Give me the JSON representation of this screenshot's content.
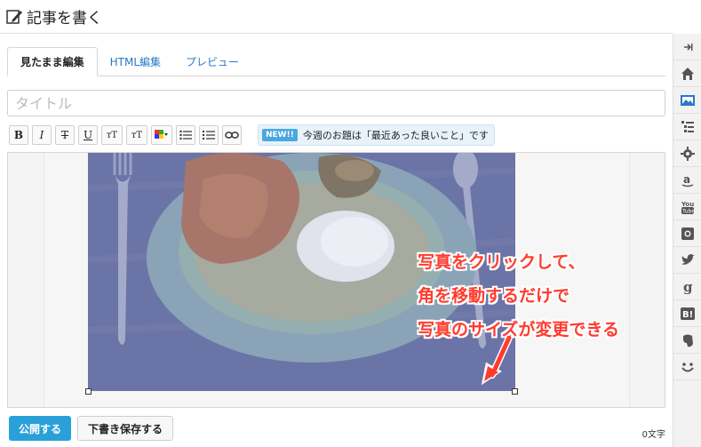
{
  "header": {
    "title": "記事を書く"
  },
  "tabs": [
    {
      "label": "見たまま編集",
      "active": true
    },
    {
      "label": "HTML編集",
      "active": false
    },
    {
      "label": "プレビュー",
      "active": false
    }
  ],
  "title_input": {
    "placeholder": "タイトル",
    "value": ""
  },
  "toolbar": {
    "bold": "B",
    "italic": "I",
    "strike": "T",
    "underline": "U",
    "size_up": "тT",
    "size_down": "тT"
  },
  "theme": {
    "badge": "NEW!!",
    "text": "今週のお題は「最近あった良いこと」です"
  },
  "annotation": {
    "lines": [
      "写真をクリックして、",
      "角を移動するだけで",
      "写真のサイズが変更できる"
    ],
    "color": "#ff3b2e"
  },
  "footer": {
    "publish_label": "公開する",
    "draft_label": "下書き保存する",
    "char_count": "0文字"
  },
  "sidebar": {
    "items": [
      {
        "icon": "collapse-icon"
      },
      {
        "icon": "home-icon"
      },
      {
        "icon": "photo-icon"
      },
      {
        "icon": "category-icon"
      },
      {
        "icon": "gear-icon"
      },
      {
        "icon": "amazon-icon"
      },
      {
        "icon": "youtube-icon",
        "text": "You"
      },
      {
        "icon": "instagram-icon"
      },
      {
        "icon": "twitter-icon"
      },
      {
        "icon": "google-icon",
        "text": "g"
      },
      {
        "icon": "hatena-bookmark-icon",
        "text": "B!"
      },
      {
        "icon": "evernote-icon"
      },
      {
        "icon": "smile-icon"
      }
    ]
  },
  "colors": {
    "accent": "#2aa0d8",
    "link": "#2a78c8"
  }
}
